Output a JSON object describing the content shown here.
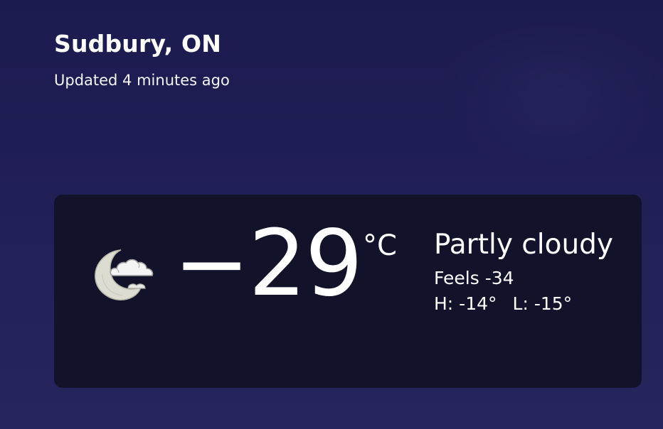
{
  "location": {
    "name": "Sudbury, ON",
    "updated": "Updated 4 minutes ago"
  },
  "current": {
    "icon": "partly-cloudy-night-icon",
    "temperature": "−29",
    "unit": "°C",
    "condition": "Partly cloudy",
    "feels_like": "Feels -34",
    "high": "H: -14°",
    "low": "L: -15°"
  },
  "colors": {
    "background": "#1f1e55",
    "card": "#12122b",
    "text": "#ffffff",
    "moon": "#d8d8cc",
    "cloud": "#f2f2f2"
  }
}
